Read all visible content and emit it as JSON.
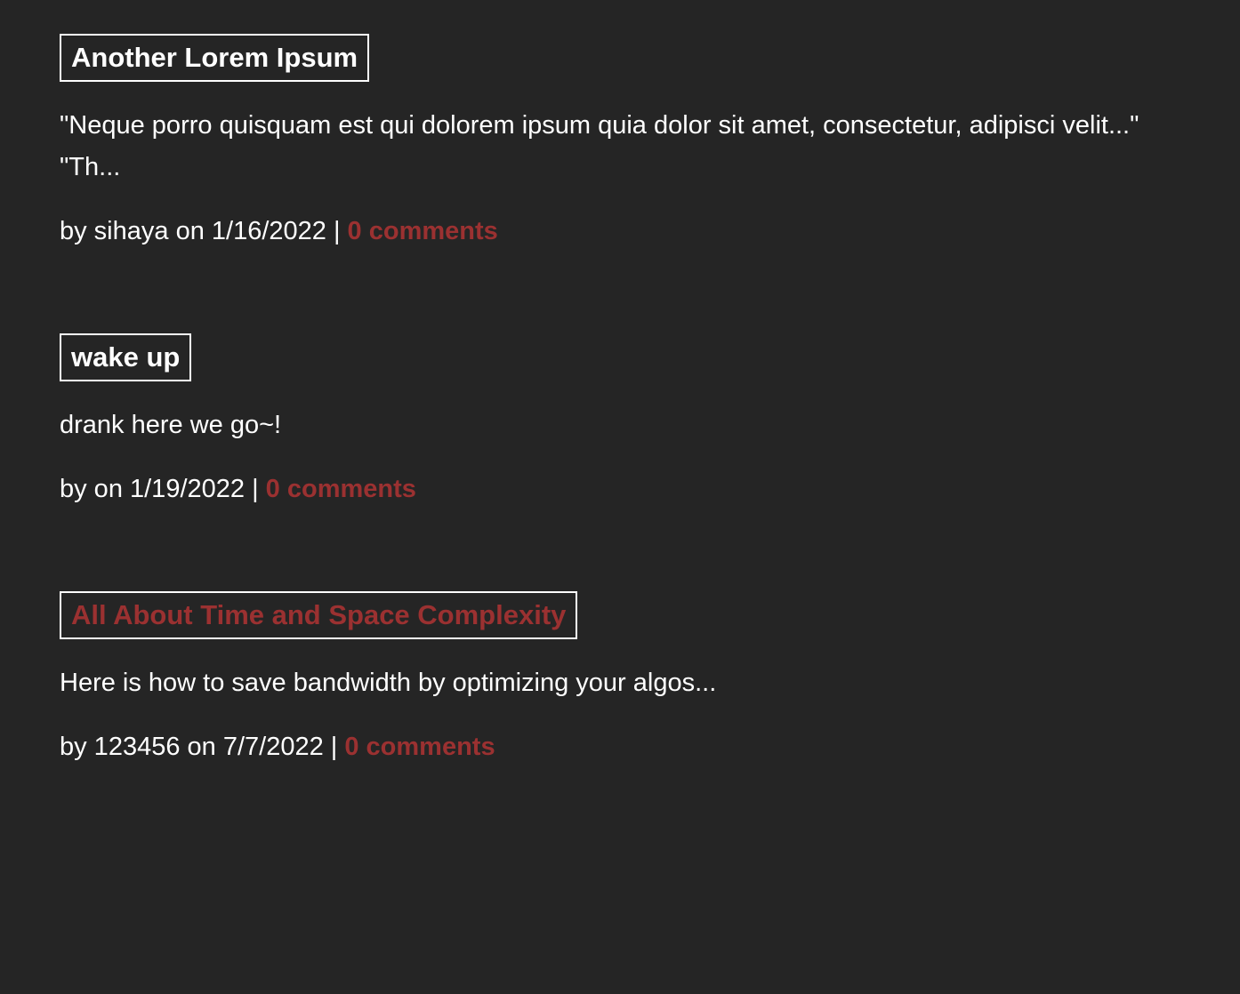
{
  "posts": [
    {
      "title": "Another Lorem Ipsum",
      "title_is_link": false,
      "excerpt": "\"Neque porro quisquam est qui dolorem ipsum quia dolor sit amet, consectetur, adipisci velit...\" \"Th...",
      "meta_prefix": "by sihaya on 1/16/2022 | ",
      "comments_label": "0 comments"
    },
    {
      "title": "wake up",
      "title_is_link": false,
      "excerpt": "drank here we go~!",
      "meta_prefix": "by on 1/19/2022 | ",
      "comments_label": "0 comments"
    },
    {
      "title": "All About Time and Space Complexity",
      "title_is_link": true,
      "excerpt": "Here is how to save bandwidth by optimizing your algos...",
      "meta_prefix": "by 123456 on 7/7/2022 | ",
      "comments_label": "0 comments"
    }
  ],
  "colors": {
    "background": "#252525",
    "text": "#ffffff",
    "accent": "#9b3131",
    "title_border": "#ffffff"
  }
}
